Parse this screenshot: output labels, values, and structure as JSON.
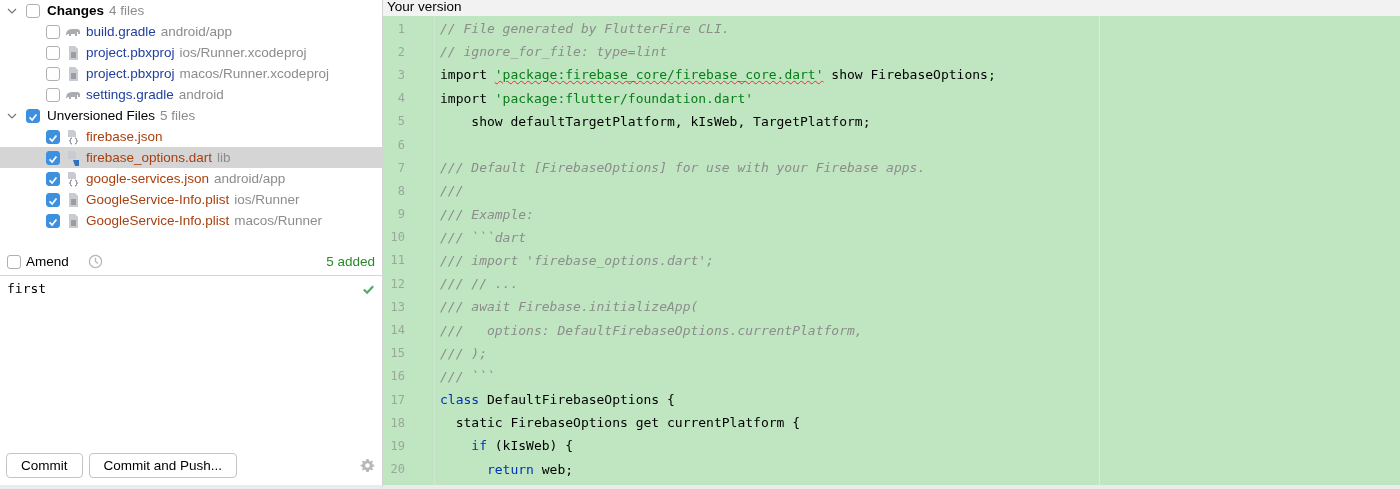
{
  "changes": {
    "groups": [
      {
        "kind": "changes",
        "label": "Changes",
        "count": "4 files",
        "expanded": true,
        "checked": false,
        "files": [
          {
            "kind": "gradle",
            "name": "build.gradle",
            "path": "android/app",
            "checked": false,
            "selected": false
          },
          {
            "kind": "text",
            "name": "project.pbxproj",
            "path": "ios/Runner.xcodeproj",
            "checked": false,
            "selected": false
          },
          {
            "kind": "text",
            "name": "project.pbxproj",
            "path": "macos/Runner.xcodeproj",
            "checked": false,
            "selected": false
          },
          {
            "kind": "gradle",
            "name": "settings.gradle",
            "path": "android",
            "checked": false,
            "selected": false
          }
        ]
      },
      {
        "kind": "unversioned",
        "label": "Unversioned Files",
        "count": "5 files",
        "expanded": true,
        "checked": true,
        "files": [
          {
            "kind": "json",
            "name": "firebase.json",
            "checked": true,
            "selected": false
          },
          {
            "kind": "dart",
            "name": "firebase_options.dart",
            "path": "lib",
            "checked": true,
            "selected": true
          },
          {
            "kind": "json",
            "name": "google-services.json",
            "path": "android/app",
            "checked": true,
            "selected": false
          },
          {
            "kind": "text",
            "name": "GoogleService-Info.plist",
            "path": "ios/Runner",
            "checked": true,
            "selected": false
          },
          {
            "kind": "text",
            "name": "GoogleService-Info.plist",
            "path": "macos/Runner",
            "checked": true,
            "selected": false
          }
        ]
      }
    ]
  },
  "amend": {
    "label": "Amend",
    "checked": false,
    "summary": "5 added"
  },
  "message": {
    "value": "first",
    "valid": true
  },
  "buttons": [
    "Commit",
    "Commit and Push..."
  ],
  "diff": {
    "title": "Your version",
    "lines": [
      {
        "number": "1",
        "tokens": [
          {
            "kind": "comment",
            "text": "// File generated by FlutterFire CLI."
          }
        ]
      },
      {
        "number": "2",
        "tokens": [
          {
            "kind": "comment",
            "text": "// ignore_for_file: type=lint"
          }
        ]
      },
      {
        "number": "3",
        "tokens": [
          {
            "kind": "plain",
            "text": "import "
          },
          {
            "kind": "flagged_string",
            "text": "'package:firebase_core/firebase_core.dart'"
          },
          {
            "kind": "plain",
            "text": " show FirebaseOptions;"
          }
        ]
      },
      {
        "number": "4",
        "tokens": [
          {
            "kind": "plain",
            "text": "import "
          },
          {
            "kind": "string",
            "text": "'package:flutter/foundation.dart'"
          }
        ]
      },
      {
        "number": "5",
        "tokens": [
          {
            "kind": "plain",
            "text": "    show defaultTargetPlatform, kIsWeb, TargetPlatform;"
          }
        ]
      },
      {
        "number": "6"
      },
      {
        "number": "7",
        "tokens": [
          {
            "kind": "comment",
            "text": "/// Default [FirebaseOptions] for use with your Firebase apps."
          }
        ]
      },
      {
        "number": "8",
        "tokens": [
          {
            "kind": "comment",
            "text": "///"
          }
        ]
      },
      {
        "number": "9",
        "tokens": [
          {
            "kind": "comment",
            "text": "/// Example:"
          }
        ]
      },
      {
        "number": "10",
        "tokens": [
          {
            "kind": "comment",
            "text": "/// ```dart"
          }
        ]
      },
      {
        "number": "11",
        "tokens": [
          {
            "kind": "comment",
            "text": "/// import 'firebase_options.dart';"
          }
        ]
      },
      {
        "number": "12",
        "tokens": [
          {
            "kind": "comment",
            "text": "/// // ..."
          }
        ]
      },
      {
        "number": "13",
        "tokens": [
          {
            "kind": "comment",
            "text": "/// await Firebase.initializeApp("
          }
        ]
      },
      {
        "number": "14",
        "tokens": [
          {
            "kind": "comment",
            "text": "///   options: DefaultFirebaseOptions.currentPlatform,"
          }
        ]
      },
      {
        "number": "15",
        "tokens": [
          {
            "kind": "comment",
            "text": "/// );"
          }
        ]
      },
      {
        "number": "16",
        "tokens": [
          {
            "kind": "comment",
            "text": "/// ```"
          }
        ]
      },
      {
        "number": "17",
        "tokens": [
          {
            "kind": "keyword",
            "text": "class"
          },
          {
            "kind": "plain",
            "text": " DefaultFirebaseOptions {"
          }
        ]
      },
      {
        "number": "18",
        "tokens": [
          {
            "kind": "plain",
            "text": "  static FirebaseOptions get currentPlatform {"
          }
        ]
      },
      {
        "number": "19",
        "tokens": [
          {
            "kind": "keyword",
            "text": "    if"
          },
          {
            "kind": "plain",
            "text": " (kIsWeb) {"
          }
        ]
      },
      {
        "number": "20",
        "tokens": [
          {
            "kind": "keyword",
            "text": "      return"
          },
          {
            "kind": "plain",
            "text": " web;"
          }
        ]
      }
    ]
  }
}
